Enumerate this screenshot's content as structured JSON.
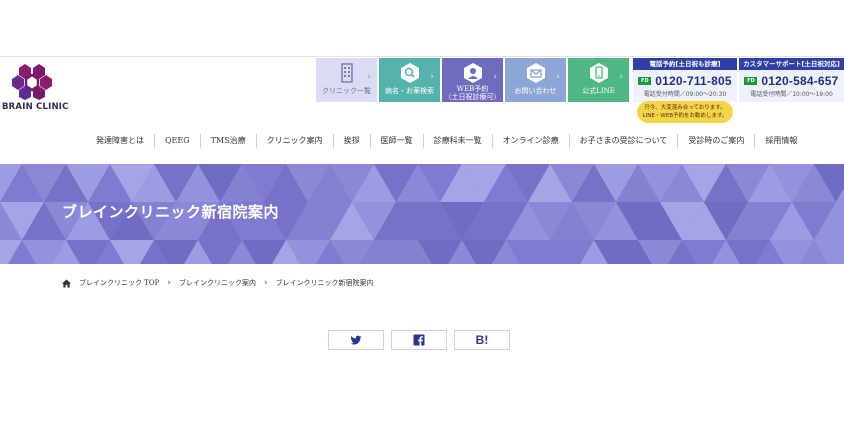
{
  "brand": {
    "name": "BRAIN CLINIC",
    "logo_color": "#7a1a6a"
  },
  "header_tiles": [
    {
      "label": "クリニック一覧",
      "icon": "building-icon"
    },
    {
      "label": "病名・お薬検索",
      "icon": "magnifier-icon"
    },
    {
      "label_line1": "WEB予約",
      "label_line2": "（土日祝診療可）",
      "icon": "doctor-icon"
    },
    {
      "label": "お問い合わせ",
      "icon": "mail-icon"
    },
    {
      "label": "公式LINE",
      "icon": "line-phone-icon"
    }
  ],
  "phones": [
    {
      "heading": "電話予約[土日祝も診療]",
      "badge": "FD",
      "number": "0120-711-805",
      "hours": "電話受付時間／09:00〜20:30"
    },
    {
      "heading": "カスタマーサポート[土日祝対応]",
      "badge": "FD",
      "number": "0120-584-657",
      "hours": "電話受付時間／10:00〜19:00"
    }
  ],
  "notice": {
    "line1": "只今、大変混み合っております。",
    "line2": "LINE・WEB予約をお勧めします。"
  },
  "global_nav": [
    "発達障害とは",
    "QEEG",
    "TMS治療",
    "クリニック案内",
    "挨拶",
    "医師一覧",
    "診療科未一覧",
    "オンライン診療",
    "お子さまの受診について",
    "受診時のご案内",
    "採用情報"
  ],
  "hero": {
    "title": "ブレインクリニック新宿院案内"
  },
  "breadcrumb": [
    "ブレインクリニック TOP",
    "ブレインクリニック案内",
    "ブレインクリニック新宿院案内"
  ],
  "share": {
    "twitter_icon": "twitter-icon",
    "facebook_icon": "facebook-icon",
    "hatena_label": "B!"
  },
  "colors": {
    "hero": "#8a86d6",
    "accent_navy": "#2f3fa6",
    "share_blue": "#2e3590"
  }
}
